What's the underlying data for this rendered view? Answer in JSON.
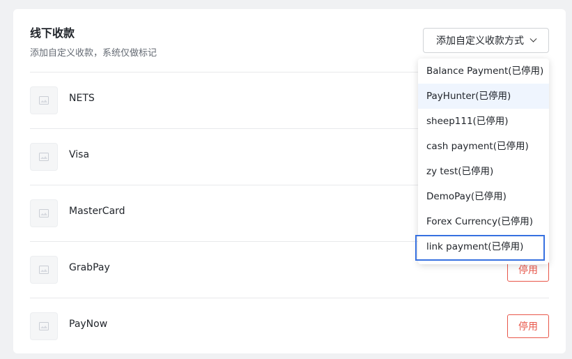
{
  "section": {
    "title": "线下收款",
    "subtitle": "添加自定义收款，系统仅做标记",
    "add_button_label": "添加自定义收款方式"
  },
  "methods": [
    {
      "name": "NETS",
      "action": ""
    },
    {
      "name": "Visa",
      "action": ""
    },
    {
      "name": "MasterCard",
      "action": ""
    },
    {
      "name": "GrabPay",
      "action": "停用"
    },
    {
      "name": "PayNow",
      "action": "停用"
    }
  ],
  "dropdown": {
    "items": [
      "Balance Payment(已停用)",
      "PayHunter(已停用)",
      "sheep111(已停用)",
      "cash payment(已停用)",
      "zy test(已停用)",
      "DemoPay(已停用)",
      "Forex Currency(已停用)",
      "link payment(已停用)"
    ],
    "hovered_index": 1,
    "highlighted_index": 7
  },
  "colors": {
    "accent": "#3670e0",
    "danger": "#e8574a",
    "hover_bg": "#eff5fe"
  }
}
